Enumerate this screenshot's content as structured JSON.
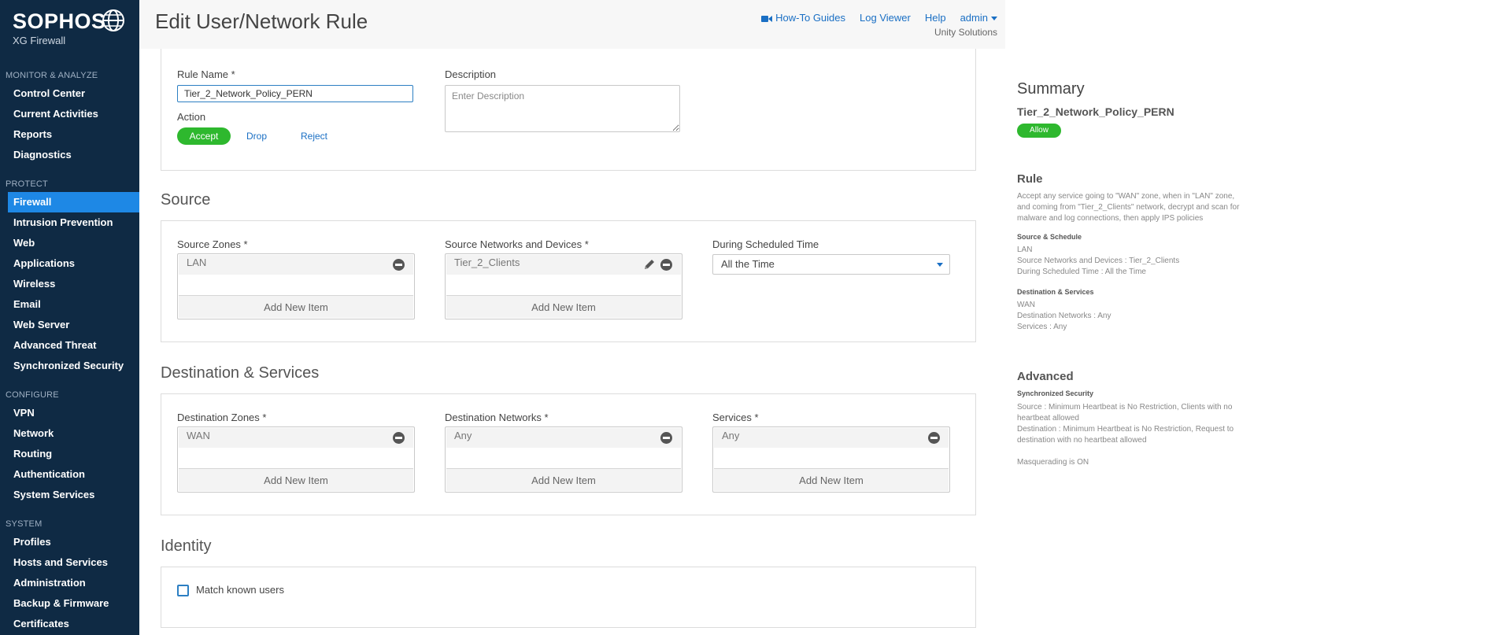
{
  "brand": {
    "name": "SOPHOS",
    "product": "XG Firewall"
  },
  "sidebar": {
    "sections": [
      {
        "title": "MONITOR & ANALYZE",
        "items": [
          "Control Center",
          "Current Activities",
          "Reports",
          "Diagnostics"
        ]
      },
      {
        "title": "PROTECT",
        "items": [
          "Firewall",
          "Intrusion Prevention",
          "Web",
          "Applications",
          "Wireless",
          "Email",
          "Web Server",
          "Advanced Threat",
          "Synchronized Security"
        ]
      },
      {
        "title": "CONFIGURE",
        "items": [
          "VPN",
          "Network",
          "Routing",
          "Authentication",
          "System Services"
        ]
      },
      {
        "title": "SYSTEM",
        "items": [
          "Profiles",
          "Hosts and Services",
          "Administration",
          "Backup & Firmware",
          "Certificates"
        ]
      }
    ],
    "active": "Firewall"
  },
  "header": {
    "title": "Edit User/Network Rule",
    "links": {
      "guides": "How-To Guides",
      "log_viewer": "Log Viewer",
      "help": "Help",
      "admin": "admin"
    },
    "company": "Unity Solutions"
  },
  "rule": {
    "name_label": "Rule Name *",
    "name_value": "Tier_2_Network_Policy_PERN",
    "description_label": "Description",
    "description_placeholder": "Enter Description",
    "action_label": "Action",
    "actions": [
      "Accept",
      "Drop",
      "Reject"
    ],
    "active_action": "Accept"
  },
  "source": {
    "title": "Source",
    "zones_label": "Source Zones *",
    "zones_value": "LAN",
    "networks_label": "Source Networks and Devices *",
    "networks_value": "Tier_2_Clients",
    "schedule_label": "During Scheduled Time",
    "schedule_value": "All the Time",
    "add_label": "Add New Item"
  },
  "destination": {
    "title": "Destination & Services",
    "zones_label": "Destination Zones *",
    "zones_value": "WAN",
    "networks_label": "Destination Networks *",
    "networks_value": "Any",
    "services_label": "Services *",
    "services_value": "Any",
    "add_label": "Add New Item"
  },
  "identity": {
    "title": "Identity",
    "match_label": "Match known users"
  },
  "summary": {
    "title": "Summary",
    "rule_name": "Tier_2_Network_Policy_PERN",
    "badge": "Allow",
    "rule_heading": "Rule",
    "rule_desc": "Accept any service going to \"WAN\" zone, when in \"LAN\" zone, and coming from \"Tier_2_Clients\" network, decrypt and scan for malware and log connections, then apply IPS policies",
    "source_heading": "Source & Schedule",
    "source_lines": [
      "LAN",
      "Source Networks and Devices : Tier_2_Clients",
      "During Scheduled Time : All the Time"
    ],
    "dest_heading": "Destination & Services",
    "dest_lines": [
      "WAN",
      "Destination Networks : Any",
      "Services : Any"
    ],
    "advanced_heading": "Advanced",
    "sync_heading": "Synchronized Security",
    "sync_source": "Source : Minimum Heartbeat is No Restriction, Clients with no heartbeat allowed",
    "sync_dest": "Destination : Minimum Heartbeat is No Restriction, Request to destination with no heartbeat allowed",
    "masquerading": "Masquerading is ON"
  },
  "colors": {
    "sidebar_bg": "#0f2a44",
    "active_nav": "#1e88e5",
    "accept_green": "#2eb82e",
    "link_blue": "#1a6fc4"
  }
}
